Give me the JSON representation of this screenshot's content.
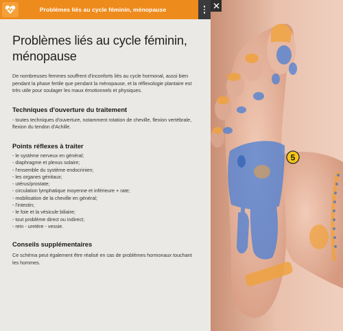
{
  "header": {
    "title": "Problèmes liés au cycle féminin, ménopause",
    "icon": "heart-pulse-icon",
    "accent": "#ee8b1d"
  },
  "content": {
    "title": "Problèmes liés au cycle féminin, ménopause",
    "intro": "De nombreuses femmes souffrent d'inconforts liés au cycle hormonal, aussi bien pendant la phase fertile que pendant la ménopause, et la réflexologie plantaire est très utile pour soulager les maux émotionnels et physiques.",
    "section1": {
      "heading": "Techniques d'ouverture du traitement",
      "text": "- toutes techniques d'ouverture, notamment rotation de cheville, flexion vertébrale, flexion du tendon d'Achille."
    },
    "section2": {
      "heading": "Points réflexes à traiter",
      "items": [
        "- le système nerveux en général;",
        "- diaphragme et plexus solaire;",
        "- l'ensemble du système endocrinien;",
        "- les organes génitaux;",
        "- utérus/prostate;",
        "- circulation lymphatique moyenne et inférieure + rate;",
        "- mobilisation de la cheville en général;",
        "- l'intestin;",
        "- le foie et la vésicule biliaire;",
        "- tout problème direct ou indirect;",
        "- rein - uretère - vessie."
      ]
    },
    "section3": {
      "heading": "Conseils supplémentaires",
      "text": "Ce schéma peut également être réalisé en cas de problèmes hormonaux touchant les hommes."
    }
  },
  "illustration": {
    "marker_label": "5",
    "marker_color": "#f5c518",
    "zone_blue": "#4a7fd6",
    "zone_orange": "#f0a23a",
    "skin": "#e7b8a2"
  },
  "controls": {
    "close_icon": "close-icon",
    "menu_icon": "kebab-menu-icon"
  }
}
